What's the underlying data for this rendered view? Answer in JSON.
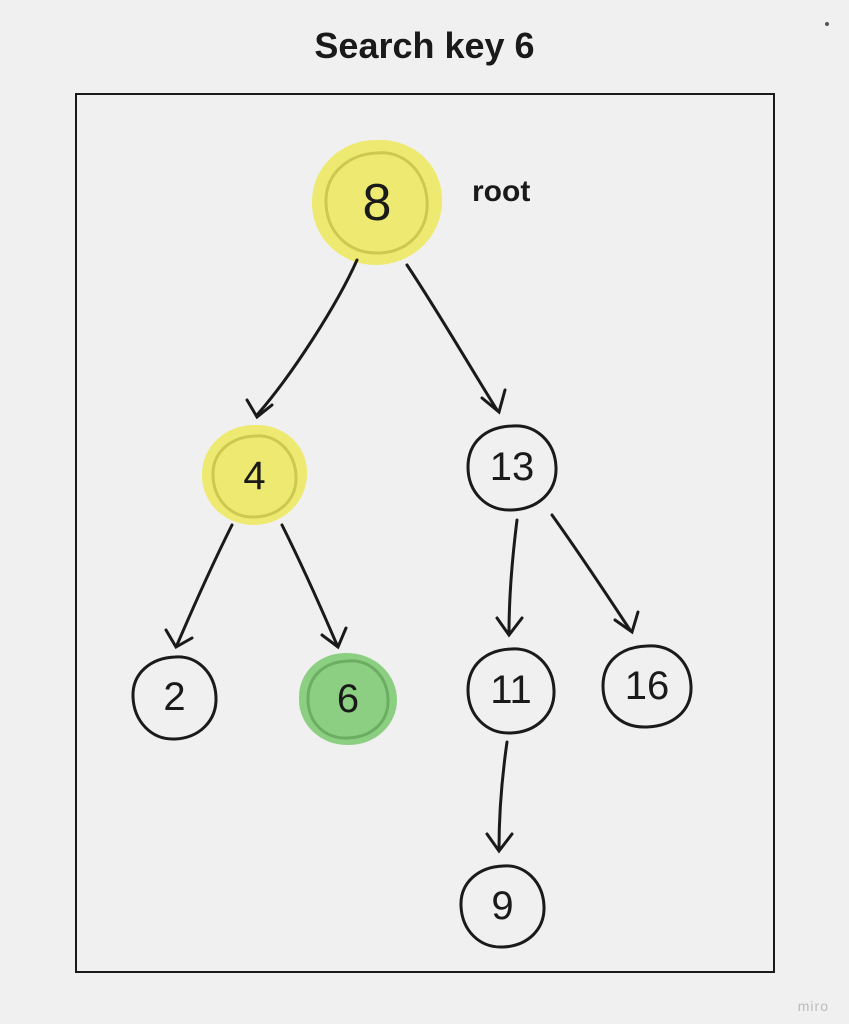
{
  "title": "Search key 6",
  "root_label": "root",
  "watermark": "miro",
  "nodes": {
    "root": {
      "value": "8",
      "highlight": "yellow"
    },
    "n4": {
      "value": "4",
      "highlight": "yellow"
    },
    "n13": {
      "value": "13",
      "highlight": "none"
    },
    "n2": {
      "value": "2",
      "highlight": "none"
    },
    "n6": {
      "value": "6",
      "highlight": "green"
    },
    "n11": {
      "value": "11",
      "highlight": "none"
    },
    "n16": {
      "value": "16",
      "highlight": "none"
    },
    "n9": {
      "value": "9",
      "highlight": "none"
    }
  },
  "tree": {
    "description": "Binary search tree; search path for key 6 highlighted",
    "edges": [
      [
        "8",
        "4"
      ],
      [
        "8",
        "13"
      ],
      [
        "4",
        "2"
      ],
      [
        "4",
        "6"
      ],
      [
        "13",
        "11"
      ],
      [
        "13",
        "16"
      ],
      [
        "11",
        "9"
      ]
    ],
    "search_path": [
      "8",
      "4",
      "6"
    ],
    "found_key": "6"
  },
  "colors": {
    "visited": "#ede95a",
    "found": "#7bc96f",
    "stroke": "#1a1a1a",
    "background": "#f0f0f0"
  }
}
